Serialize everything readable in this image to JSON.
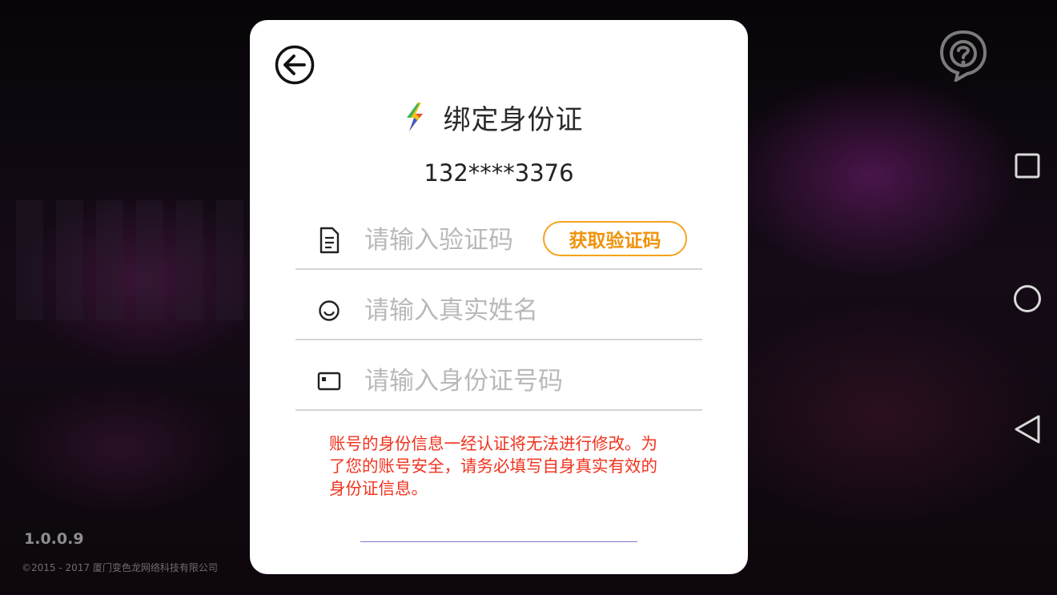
{
  "app": {
    "version": "1.0.0.9",
    "copyright": "©2015 - 2017 厦门变色龙网络科技有限公司"
  },
  "dialog": {
    "title": "绑定身份证",
    "phone": "132****3376",
    "fields": {
      "code_placeholder": "请输入验证码",
      "name_placeholder": "请输入真实姓名",
      "id_placeholder": "请输入身份证号码"
    },
    "get_code_label": "获取验证码",
    "warning": "账号的身份信息一经认证将无法进行修改。为了您的账号安全，请务必填写自身真实有效的身份证信息。"
  },
  "icons": {
    "back": "back-arrow-icon",
    "bolt": "lightning-bolt-icon",
    "code": "document-icon",
    "name": "smiley-face-icon",
    "id": "id-card-icon",
    "help": "help-question-icon",
    "nav_square": "recent-apps-icon",
    "nav_circle": "home-icon",
    "nav_back": "back-triangle-icon"
  },
  "colors": {
    "accent": "#f5a31d",
    "warning": "#f0331e"
  }
}
